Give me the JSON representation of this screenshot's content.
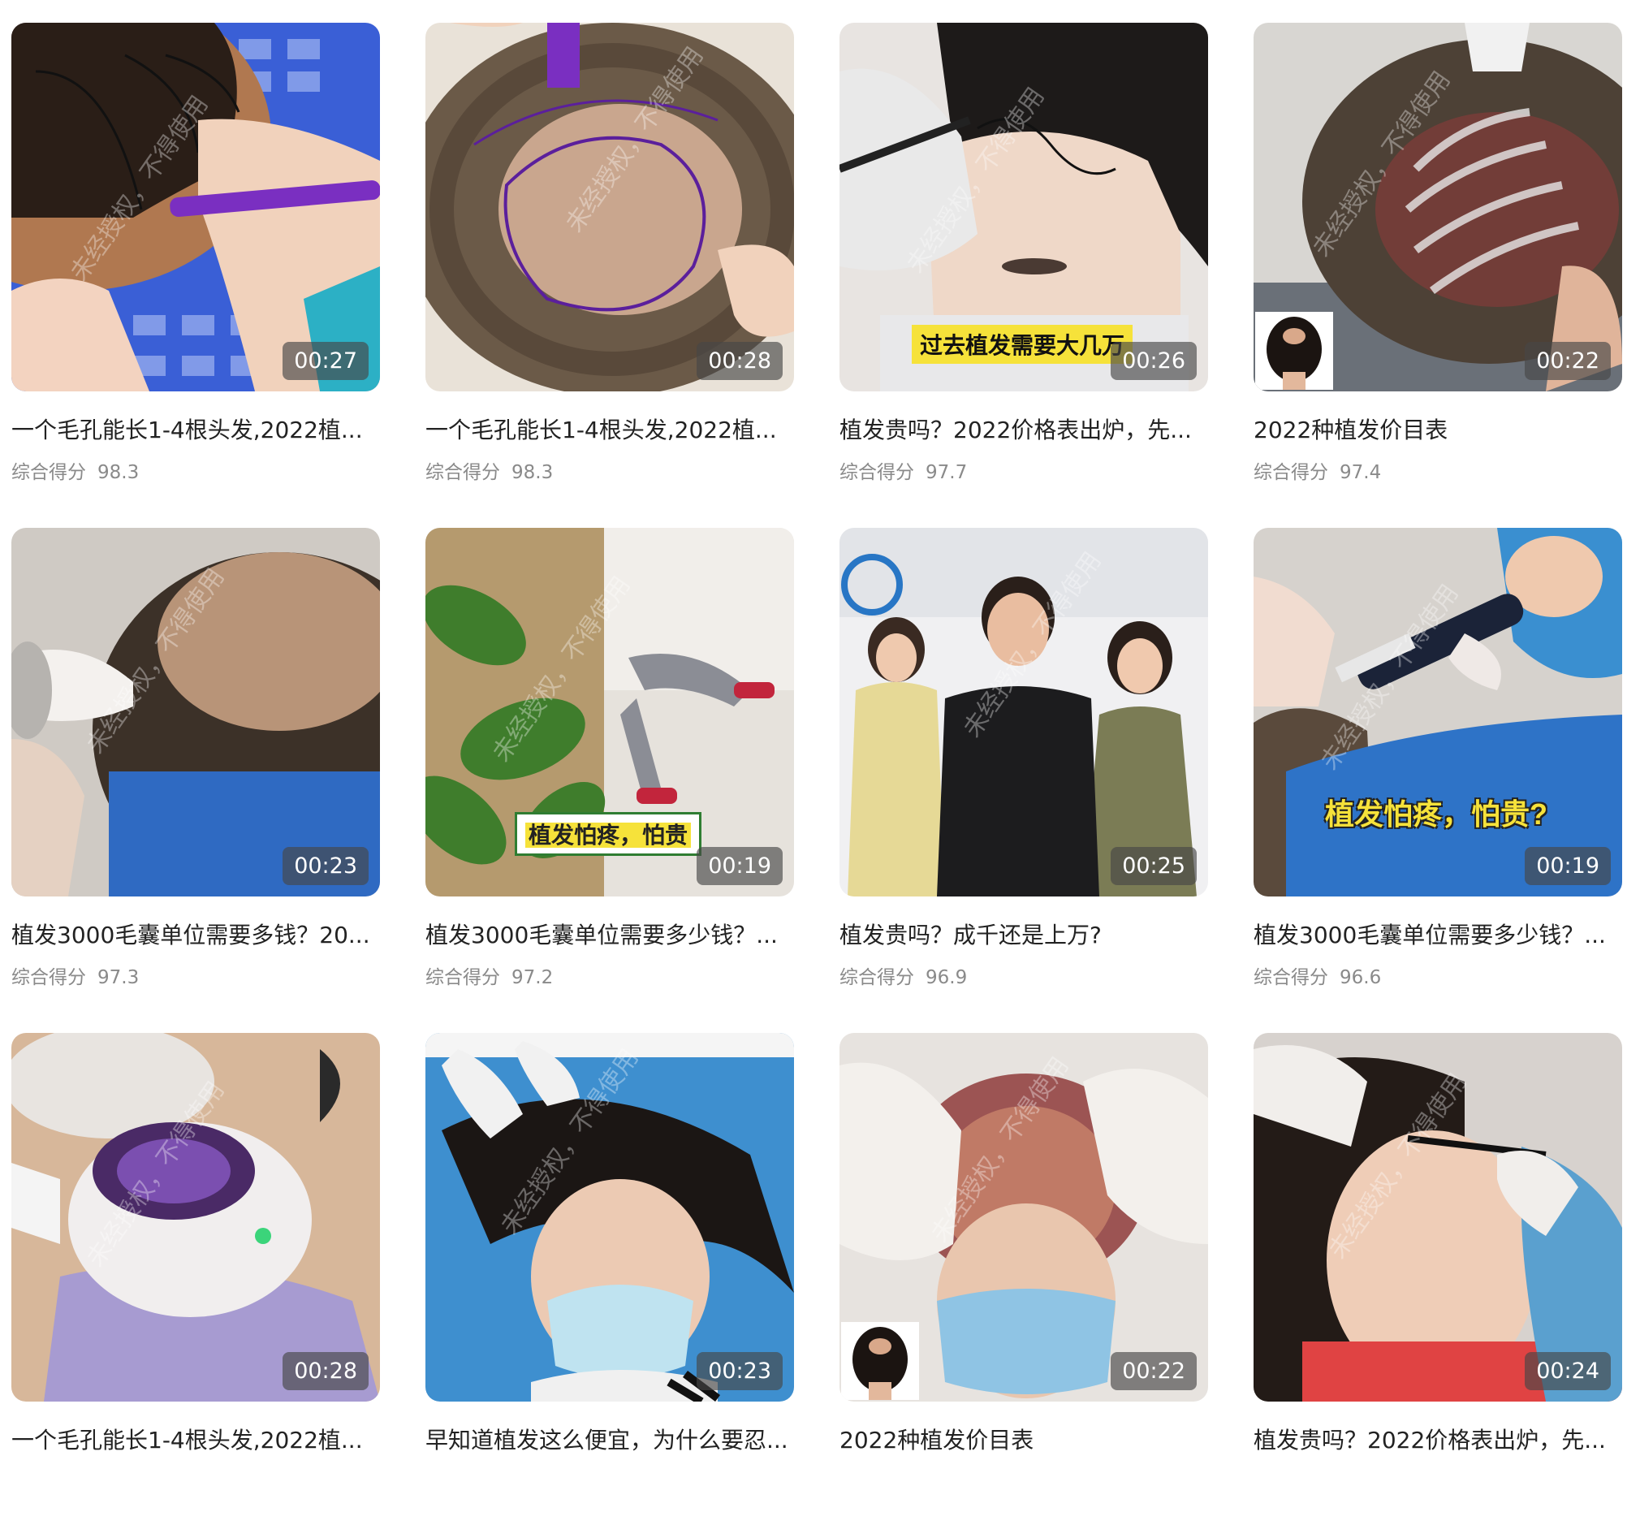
{
  "score_label": "综合得分",
  "watermark_text": "未经授权，不得使用",
  "colors": {
    "title": "#222222",
    "score": "#8a8a8a",
    "overlay_yellow": "#f6e23a",
    "duration_bg": "rgba(70,70,70,0.65)"
  },
  "cards": [
    {
      "title": "一个毛孔能长1-4根头发,2022植...",
      "score": "98.3",
      "duration": "00:27",
      "overlay": "",
      "icon": "hairline-marking-thumbnail"
    },
    {
      "title": "一个毛孔能长1-4根头发,2022植...",
      "score": "98.3",
      "duration": "00:28",
      "overlay": "",
      "icon": "crown-marking-thumbnail"
    },
    {
      "title": "植发贵吗？2022价格表出炉，先...",
      "score": "97.7",
      "duration": "00:26",
      "overlay": "过去植发需要大几万",
      "icon": "forehead-marking-thumbnail"
    },
    {
      "title": "2022种植发价目表",
      "score": "97.4",
      "duration": "00:22",
      "overlay": "",
      "icon": "scalp-graft-thumbnail"
    },
    {
      "title": "植发3000毛囊单位需要多钱？20...",
      "score": "97.3",
      "duration": "00:23",
      "overlay": "",
      "icon": "shaved-head-thumbnail"
    },
    {
      "title": "植发3000毛囊单位需要多少钱？...",
      "score": "97.2",
      "duration": "00:19",
      "overlay": "植发怕疼，怕贵",
      "icon": "clinic-lobby-thumbnail"
    },
    {
      "title": "植发贵吗？成千还是上万?",
      "score": "96.9",
      "duration": "00:25",
      "overlay": "",
      "icon": "group-photo-thumbnail"
    },
    {
      "title": "植发3000毛囊单位需要多少钱？...",
      "score": "96.6",
      "duration": "00:19",
      "overlay": "植发怕疼，怕贵?",
      "icon": "implant-pen-thumbnail"
    },
    {
      "title": "一个毛孔能长1-4根头发,2022植...",
      "score": "",
      "duration": "00:28",
      "overlay": "",
      "icon": "laser-helmet-thumbnail"
    },
    {
      "title": "早知道植发这么便宜，为什么要忍...",
      "score": "",
      "duration": "00:23",
      "overlay": "",
      "icon": "patient-mask-thumbnail"
    },
    {
      "title": "2022种植发价目表",
      "score": "",
      "duration": "00:22",
      "overlay": "",
      "icon": "template-marking-thumbnail"
    },
    {
      "title": "植发贵吗？2022价格表出炉，先...",
      "score": "",
      "duration": "00:24",
      "overlay": "",
      "icon": "brow-marking-thumbnail"
    }
  ]
}
